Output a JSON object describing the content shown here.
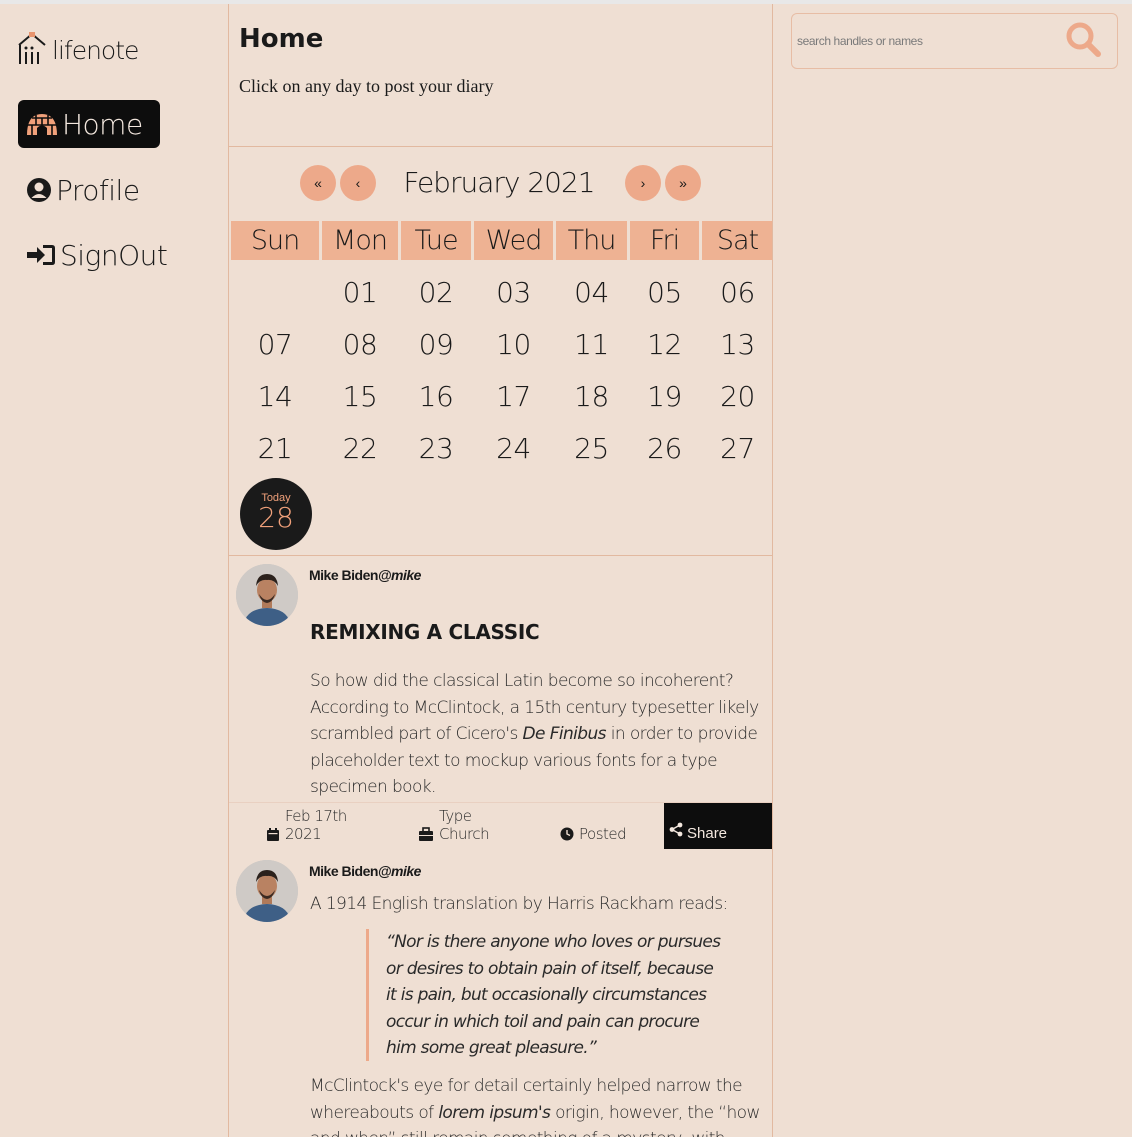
{
  "app": {
    "logo_text": "lifenote"
  },
  "nav": {
    "home": "Home",
    "profile": "Profile",
    "signout": "SignOut"
  },
  "header": {
    "title": "Home",
    "subtitle": "Click on any day to post your diary"
  },
  "calendar": {
    "month_label": "February 2021",
    "nav": {
      "first": "«",
      "prev": "‹",
      "next": "›",
      "last": "»"
    },
    "weekdays": [
      "Sun",
      "Mon",
      "Tue",
      "Wed",
      "Thu",
      "Fri",
      "Sat"
    ],
    "weeks": [
      [
        "",
        "01",
        "02",
        "03",
        "04",
        "05",
        "06"
      ],
      [
        "07",
        "08",
        "09",
        "10",
        "11",
        "12",
        "13"
      ],
      [
        "14",
        "15",
        "16",
        "17",
        "18",
        "19",
        "20"
      ],
      [
        "21",
        "22",
        "23",
        "24",
        "25",
        "26",
        "27"
      ]
    ],
    "today": {
      "label": "Today",
      "day": "28"
    }
  },
  "posts": [
    {
      "author_name": "Mike Biden",
      "author_handle": "@mike",
      "title": "REMIXING A CLASSIC",
      "body_1": "So how did the classical Latin become so incoherent? According to McClintock, a 15th century typesetter likely scrambled part of Cicero's ",
      "body_em": "De Finibus",
      "body_2": " in order to provide placeholder text to mockup various fonts for a type specimen book.",
      "date_line1": "Feb 17th",
      "date_line2": "2021",
      "type_label": "Type",
      "type_value": "Church",
      "status": "Posted",
      "share": "Share"
    },
    {
      "author_name": "Mike Biden",
      "author_handle": "@mike",
      "intro": "A 1914 English translation by Harris Rackham reads:",
      "quote": "“Nor is there anyone who loves or pursues or desires to obtain pain of itself, because it is pain, but occasionally circumstances occur in which toil and pain can procure him some great pleasure.”",
      "after_1": "McClintock's eye for detail certainly helped narrow the whereabouts of ",
      "after_em": "lorem ipsum's",
      "after_2": " origin, however, the “how and when” still remain something of a mystery, with competing"
    }
  ],
  "search": {
    "placeholder": "search handles or names"
  },
  "colors": {
    "background": "#efdfd3",
    "accent": "#eda98a",
    "dark": "#0d0d0d",
    "border": "#e2b9a0"
  }
}
